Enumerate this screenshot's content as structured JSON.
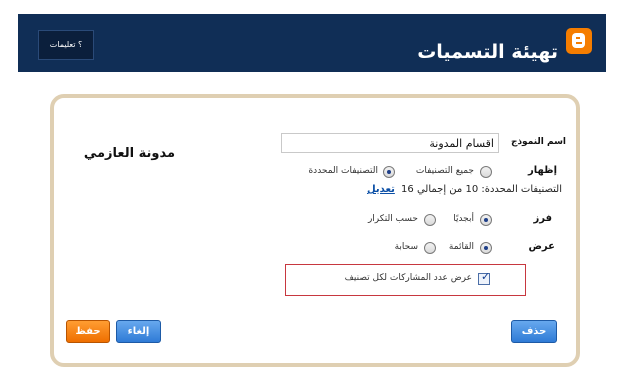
{
  "header": {
    "title": "تهيئة التسميات",
    "help_label": "؟ تعليمات",
    "colors": {
      "header_bg": "#102e56",
      "logo_orange": "#f57d00"
    }
  },
  "panel": {
    "blog_name": "مدونة العازمي",
    "fields": {
      "title_label": "اسم النموذج",
      "title_value": "اقسام المدونة",
      "show_label": "إظهار",
      "show_options": [
        "جميع التصنيفات",
        "التصنيفات المحددة"
      ],
      "show_selected": "التصنيفات المحددة",
      "selected_summary": "التصنيفات المحددة: 10 من إجمالي 16",
      "edit_link": "تعديل",
      "sort_label": "فرز",
      "sort_options": [
        "أبجديًا",
        "حسب التكرار"
      ],
      "sort_selected": "أبجديًا",
      "display_label": "عرض",
      "display_options": [
        "القائمة",
        "سحابة"
      ],
      "display_selected": "القائمة",
      "show_counts_label": "عرض عدد المشاركات لكل تصنيف",
      "show_counts_checked": true
    },
    "buttons": {
      "delete": "حذف",
      "cancel": "إلغاء",
      "save": "حفظ"
    }
  }
}
